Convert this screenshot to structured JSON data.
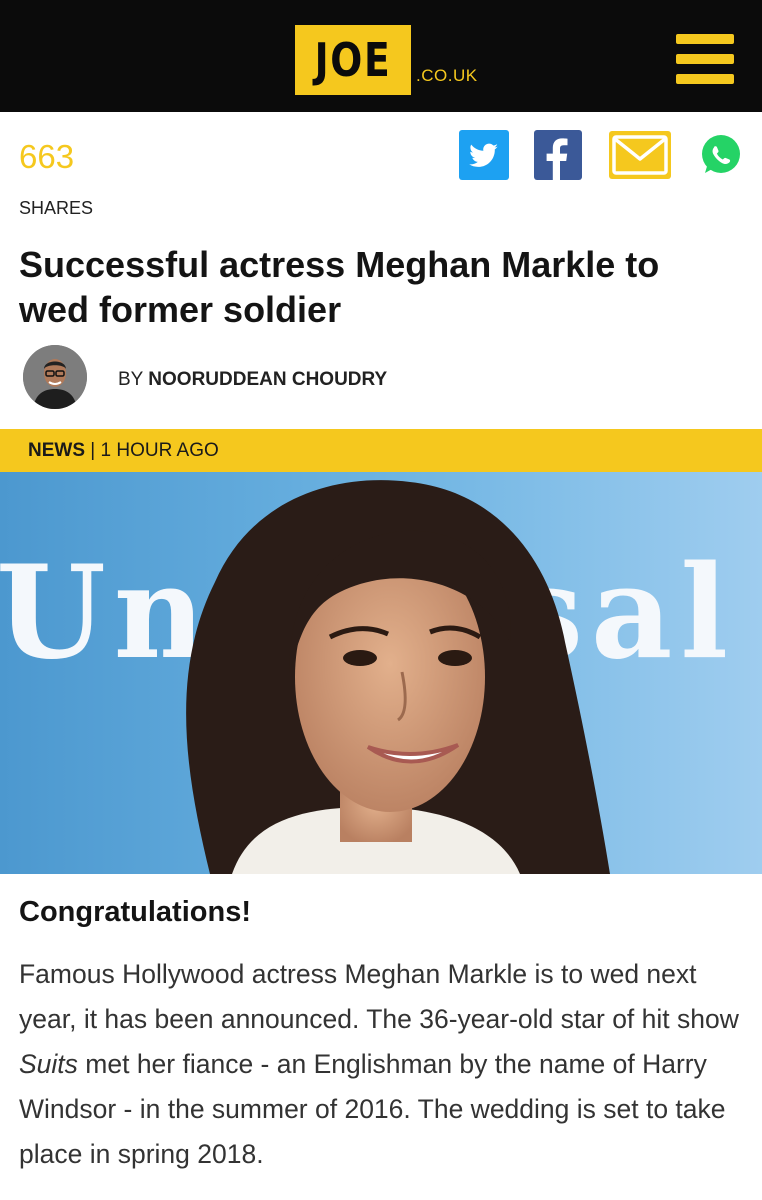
{
  "header": {
    "logo_text": "JOE",
    "logo_suffix": ".CO.UK",
    "accent_color": "#f5c81e",
    "background_color": "#0b0b0b",
    "menu_icon": "hamburger-menu-icon"
  },
  "shares": {
    "count": "663",
    "label": "SHARES",
    "icons": [
      "twitter-icon",
      "facebook-icon",
      "email-icon",
      "whatsapp-icon"
    ]
  },
  "article": {
    "headline": "Successful actress Meghan Markle to wed former soldier",
    "byline_prefix": "BY",
    "author": "NOORUDDEAN CHOUDRY",
    "category": "NEWS",
    "separator": "|",
    "time_ago": "1 HOUR AGO",
    "hero_backdrop_text": "Universal",
    "subheading": "Congratulations!",
    "body_part1": "Famous Hollywood actress Meghan Markle is to wed next year, it has been announced. The 36-year-old star of hit show ",
    "body_italic": "Suits",
    "body_part2": " met her fiance - an Englishman by the name of Harry Windsor - in the summer of 2016. The wedding is set to take place in spring 2018."
  }
}
